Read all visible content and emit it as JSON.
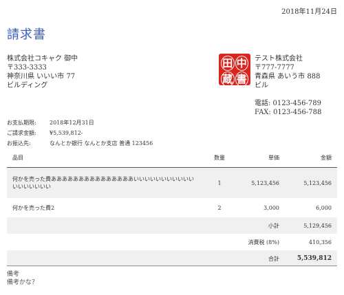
{
  "invoice": {
    "date": "2018年11月24日",
    "title": "請求書"
  },
  "recipient": {
    "name": "株式会社コキャク 御中",
    "postal": "〒333-3333",
    "address1": "神奈川県 いいい市 77",
    "address2": "ビルディング"
  },
  "seal": {
    "chars": [
      "田",
      "中",
      "蔵",
      "書"
    ],
    "color": "#d9251d"
  },
  "sender": {
    "name": "テスト株式会社",
    "postal": "〒777-7777",
    "address1": "青森県 あいう市 888",
    "address2": "ビル",
    "phone": "電話: 0123-456-789",
    "fax": "FAX: 0123-456-788"
  },
  "payment": {
    "due_label": "お支払期限:",
    "due_value": "2018年12月31日",
    "amount_label": "ご請求金額:",
    "amount_value": "¥5,539,812-",
    "bank_label": "お振込先:",
    "bank_value": "なんとか銀行 なんとか支店 普通 123456"
  },
  "table": {
    "headers": {
      "item": "品目",
      "qty": "数量",
      "unit": "単価",
      "amount": "金額"
    },
    "rows": [
      {
        "item": "何かを売った費あああああああああああああああいいいいいいいいいいいいいいいいいい",
        "qty": "1",
        "unit": "5,123,456",
        "amount": "5,123,456"
      },
      {
        "item": "何かを売った費2",
        "qty": "2",
        "unit": "3,000",
        "amount": "6,000"
      }
    ],
    "subtotal_label": "小計",
    "subtotal_value": "5,129,456",
    "tax_label": "消費税 (8%)",
    "tax_value": "410,356",
    "total_label": "合計",
    "total_value": "5,539,812"
  },
  "remarks": {
    "label": "備考",
    "text": "備考かな？"
  }
}
